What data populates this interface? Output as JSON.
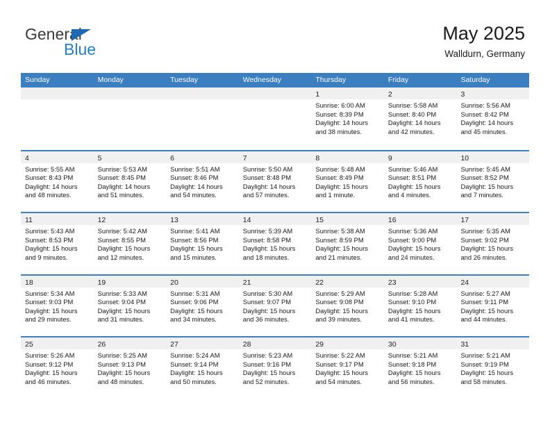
{
  "brand": {
    "name_top": "General",
    "name_bottom": "Blue",
    "triangle_color": "#1f69b3",
    "blue_color": "#1f7fd0"
  },
  "header": {
    "title": "May 2025",
    "subtitle": "Walldurn, Germany"
  },
  "theme": {
    "header_band": "#3c7fc0",
    "row_divider": "#3c7fc0",
    "date_strip": "#f0f0f0",
    "text": "#1a1a1a"
  },
  "weekdays": [
    "Sunday",
    "Monday",
    "Tuesday",
    "Wednesday",
    "Thursday",
    "Friday",
    "Saturday"
  ],
  "labels": {
    "sunrise_prefix": "Sunrise:",
    "sunset_prefix": "Sunset:",
    "daylight_prefix": "Daylight:"
  },
  "weeks": [
    [
      {
        "date": "",
        "sunrise": "",
        "sunset": "",
        "daylight_line1": "",
        "daylight_line2": ""
      },
      {
        "date": "",
        "sunrise": "",
        "sunset": "",
        "daylight_line1": "",
        "daylight_line2": ""
      },
      {
        "date": "",
        "sunrise": "",
        "sunset": "",
        "daylight_line1": "",
        "daylight_line2": ""
      },
      {
        "date": "",
        "sunrise": "",
        "sunset": "",
        "daylight_line1": "",
        "daylight_line2": ""
      },
      {
        "date": "1",
        "sunrise": "Sunrise: 6:00 AM",
        "sunset": "Sunset: 8:39 PM",
        "daylight_line1": "Daylight: 14 hours",
        "daylight_line2": "and 38 minutes."
      },
      {
        "date": "2",
        "sunrise": "Sunrise: 5:58 AM",
        "sunset": "Sunset: 8:40 PM",
        "daylight_line1": "Daylight: 14 hours",
        "daylight_line2": "and 42 minutes."
      },
      {
        "date": "3",
        "sunrise": "Sunrise: 5:56 AM",
        "sunset": "Sunset: 8:42 PM",
        "daylight_line1": "Daylight: 14 hours",
        "daylight_line2": "and 45 minutes."
      }
    ],
    [
      {
        "date": "4",
        "sunrise": "Sunrise: 5:55 AM",
        "sunset": "Sunset: 8:43 PM",
        "daylight_line1": "Daylight: 14 hours",
        "daylight_line2": "and 48 minutes."
      },
      {
        "date": "5",
        "sunrise": "Sunrise: 5:53 AM",
        "sunset": "Sunset: 8:45 PM",
        "daylight_line1": "Daylight: 14 hours",
        "daylight_line2": "and 51 minutes."
      },
      {
        "date": "6",
        "sunrise": "Sunrise: 5:51 AM",
        "sunset": "Sunset: 8:46 PM",
        "daylight_line1": "Daylight: 14 hours",
        "daylight_line2": "and 54 minutes."
      },
      {
        "date": "7",
        "sunrise": "Sunrise: 5:50 AM",
        "sunset": "Sunset: 8:48 PM",
        "daylight_line1": "Daylight: 14 hours",
        "daylight_line2": "and 57 minutes."
      },
      {
        "date": "8",
        "sunrise": "Sunrise: 5:48 AM",
        "sunset": "Sunset: 8:49 PM",
        "daylight_line1": "Daylight: 15 hours",
        "daylight_line2": "and 1 minute."
      },
      {
        "date": "9",
        "sunrise": "Sunrise: 5:46 AM",
        "sunset": "Sunset: 8:51 PM",
        "daylight_line1": "Daylight: 15 hours",
        "daylight_line2": "and 4 minutes."
      },
      {
        "date": "10",
        "sunrise": "Sunrise: 5:45 AM",
        "sunset": "Sunset: 8:52 PM",
        "daylight_line1": "Daylight: 15 hours",
        "daylight_line2": "and 7 minutes."
      }
    ],
    [
      {
        "date": "11",
        "sunrise": "Sunrise: 5:43 AM",
        "sunset": "Sunset: 8:53 PM",
        "daylight_line1": "Daylight: 15 hours",
        "daylight_line2": "and 9 minutes."
      },
      {
        "date": "12",
        "sunrise": "Sunrise: 5:42 AM",
        "sunset": "Sunset: 8:55 PM",
        "daylight_line1": "Daylight: 15 hours",
        "daylight_line2": "and 12 minutes."
      },
      {
        "date": "13",
        "sunrise": "Sunrise: 5:41 AM",
        "sunset": "Sunset: 8:56 PM",
        "daylight_line1": "Daylight: 15 hours",
        "daylight_line2": "and 15 minutes."
      },
      {
        "date": "14",
        "sunrise": "Sunrise: 5:39 AM",
        "sunset": "Sunset: 8:58 PM",
        "daylight_line1": "Daylight: 15 hours",
        "daylight_line2": "and 18 minutes."
      },
      {
        "date": "15",
        "sunrise": "Sunrise: 5:38 AM",
        "sunset": "Sunset: 8:59 PM",
        "daylight_line1": "Daylight: 15 hours",
        "daylight_line2": "and 21 minutes."
      },
      {
        "date": "16",
        "sunrise": "Sunrise: 5:36 AM",
        "sunset": "Sunset: 9:00 PM",
        "daylight_line1": "Daylight: 15 hours",
        "daylight_line2": "and 24 minutes."
      },
      {
        "date": "17",
        "sunrise": "Sunrise: 5:35 AM",
        "sunset": "Sunset: 9:02 PM",
        "daylight_line1": "Daylight: 15 hours",
        "daylight_line2": "and 26 minutes."
      }
    ],
    [
      {
        "date": "18",
        "sunrise": "Sunrise: 5:34 AM",
        "sunset": "Sunset: 9:03 PM",
        "daylight_line1": "Daylight: 15 hours",
        "daylight_line2": "and 29 minutes."
      },
      {
        "date": "19",
        "sunrise": "Sunrise: 5:33 AM",
        "sunset": "Sunset: 9:04 PM",
        "daylight_line1": "Daylight: 15 hours",
        "daylight_line2": "and 31 minutes."
      },
      {
        "date": "20",
        "sunrise": "Sunrise: 5:31 AM",
        "sunset": "Sunset: 9:06 PM",
        "daylight_line1": "Daylight: 15 hours",
        "daylight_line2": "and 34 minutes."
      },
      {
        "date": "21",
        "sunrise": "Sunrise: 5:30 AM",
        "sunset": "Sunset: 9:07 PM",
        "daylight_line1": "Daylight: 15 hours",
        "daylight_line2": "and 36 minutes."
      },
      {
        "date": "22",
        "sunrise": "Sunrise: 5:29 AM",
        "sunset": "Sunset: 9:08 PM",
        "daylight_line1": "Daylight: 15 hours",
        "daylight_line2": "and 39 minutes."
      },
      {
        "date": "23",
        "sunrise": "Sunrise: 5:28 AM",
        "sunset": "Sunset: 9:10 PM",
        "daylight_line1": "Daylight: 15 hours",
        "daylight_line2": "and 41 minutes."
      },
      {
        "date": "24",
        "sunrise": "Sunrise: 5:27 AM",
        "sunset": "Sunset: 9:11 PM",
        "daylight_line1": "Daylight: 15 hours",
        "daylight_line2": "and 44 minutes."
      }
    ],
    [
      {
        "date": "25",
        "sunrise": "Sunrise: 5:26 AM",
        "sunset": "Sunset: 9:12 PM",
        "daylight_line1": "Daylight: 15 hours",
        "daylight_line2": "and 46 minutes."
      },
      {
        "date": "26",
        "sunrise": "Sunrise: 5:25 AM",
        "sunset": "Sunset: 9:13 PM",
        "daylight_line1": "Daylight: 15 hours",
        "daylight_line2": "and 48 minutes."
      },
      {
        "date": "27",
        "sunrise": "Sunrise: 5:24 AM",
        "sunset": "Sunset: 9:14 PM",
        "daylight_line1": "Daylight: 15 hours",
        "daylight_line2": "and 50 minutes."
      },
      {
        "date": "28",
        "sunrise": "Sunrise: 5:23 AM",
        "sunset": "Sunset: 9:16 PM",
        "daylight_line1": "Daylight: 15 hours",
        "daylight_line2": "and 52 minutes."
      },
      {
        "date": "29",
        "sunrise": "Sunrise: 5:22 AM",
        "sunset": "Sunset: 9:17 PM",
        "daylight_line1": "Daylight: 15 hours",
        "daylight_line2": "and 54 minutes."
      },
      {
        "date": "30",
        "sunrise": "Sunrise: 5:21 AM",
        "sunset": "Sunset: 9:18 PM",
        "daylight_line1": "Daylight: 15 hours",
        "daylight_line2": "and 56 minutes."
      },
      {
        "date": "31",
        "sunrise": "Sunrise: 5:21 AM",
        "sunset": "Sunset: 9:19 PM",
        "daylight_line1": "Daylight: 15 hours",
        "daylight_line2": "and 58 minutes."
      }
    ]
  ]
}
